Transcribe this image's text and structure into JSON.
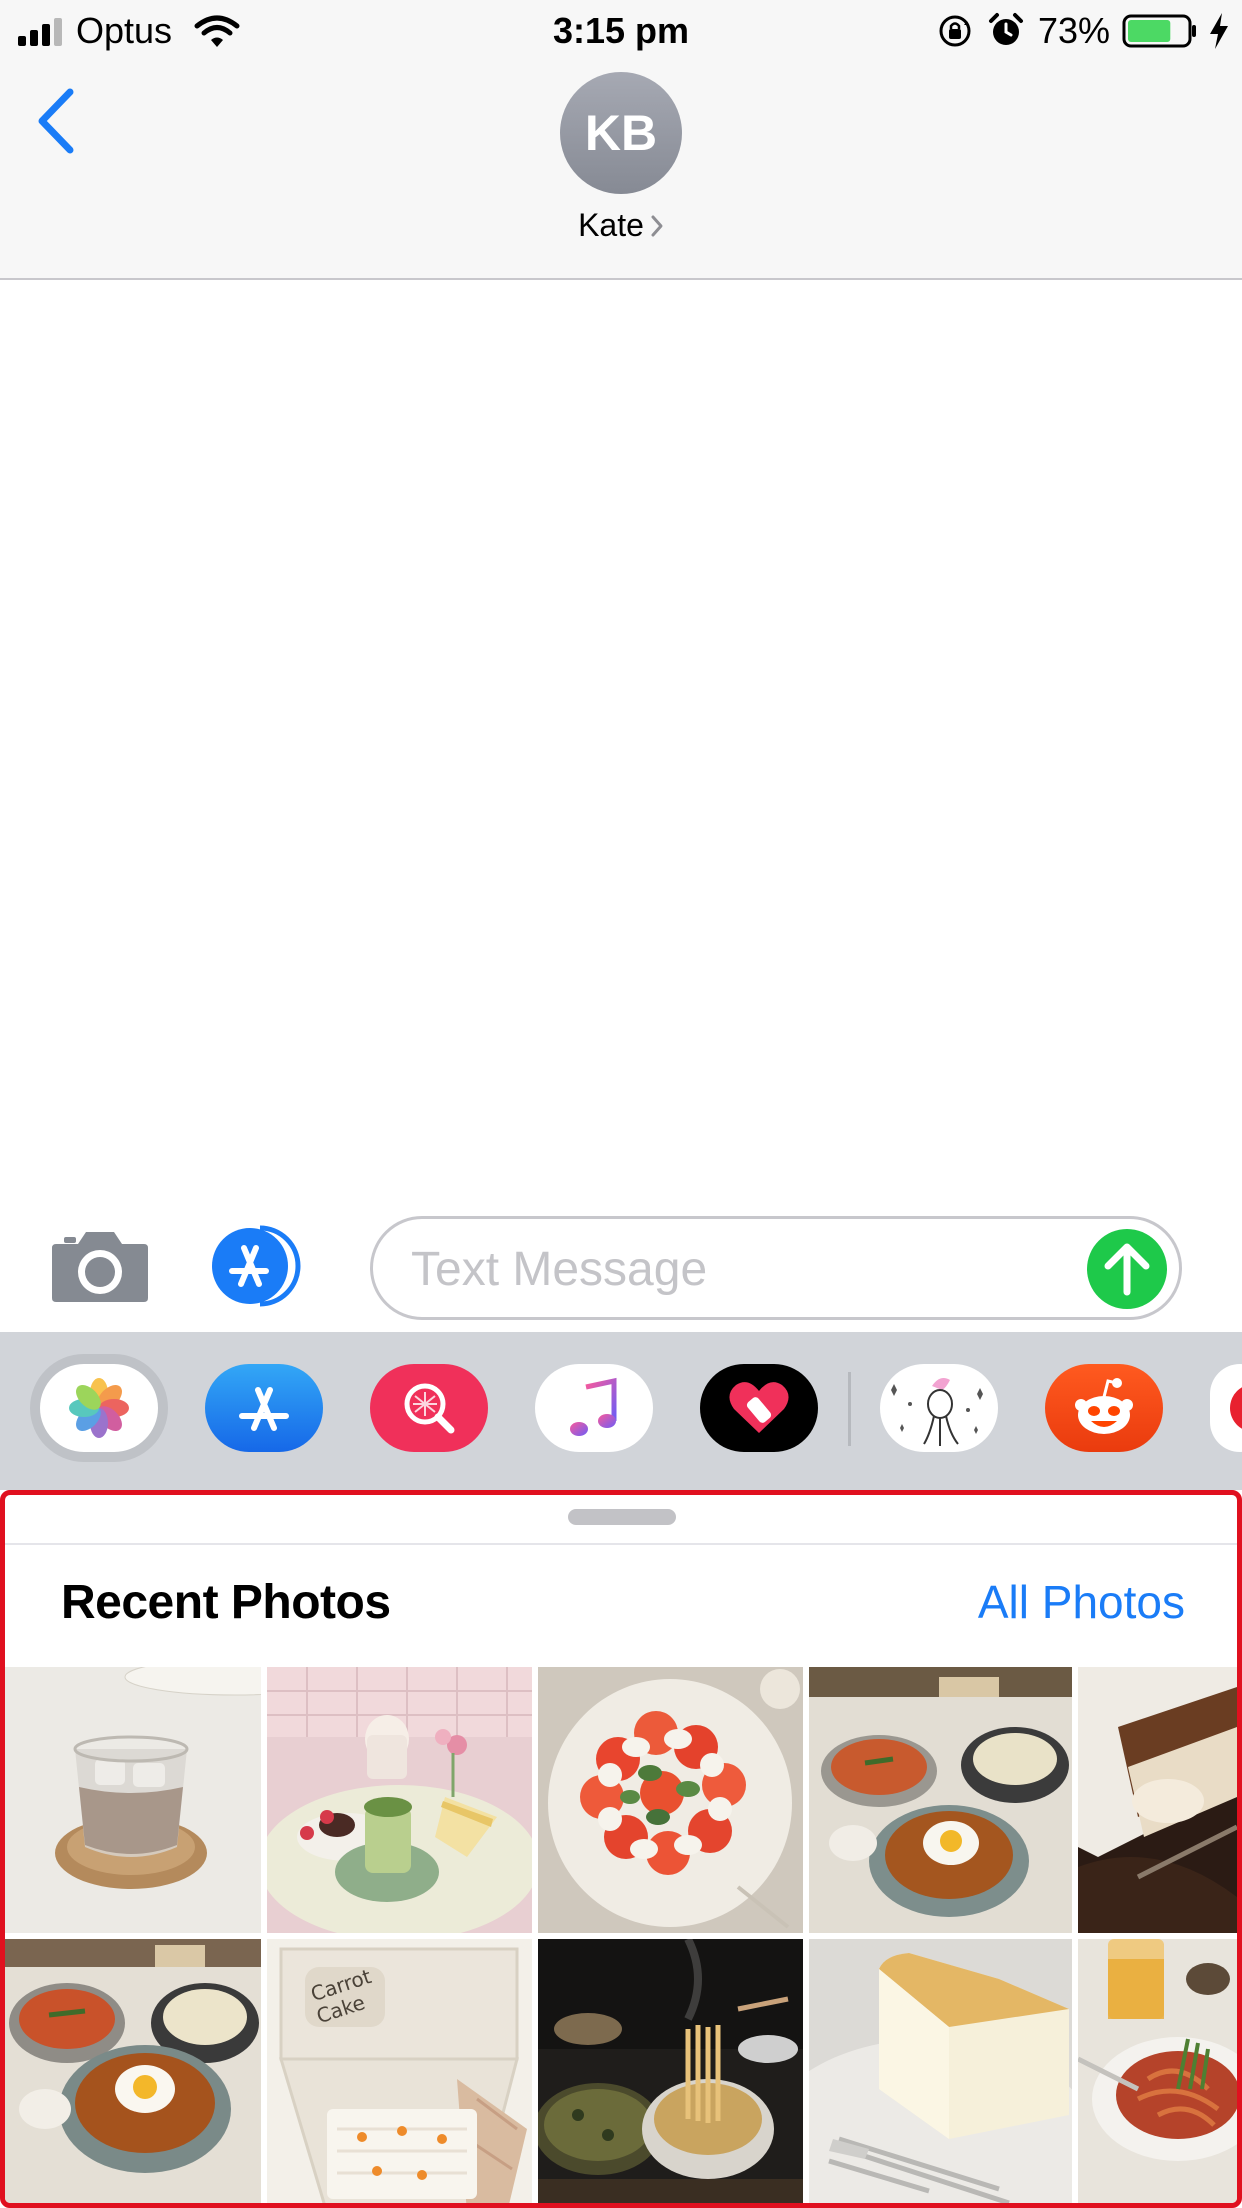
{
  "status_bar": {
    "carrier": "Optus",
    "time": "3:15 pm",
    "battery_percent": "73%",
    "battery_level": 0.73,
    "signal_bars_filled": 3,
    "signal_bars_total": 4,
    "icons": [
      "signal-icon",
      "wifi-icon",
      "orientation-lock-icon",
      "alarm-icon",
      "battery-icon",
      "charging-bolt-icon"
    ]
  },
  "header": {
    "back_icon": "chevron-left-icon",
    "avatar_initials": "KB",
    "contact_name": "Kate",
    "contact_chevron": "chevron-right-icon"
  },
  "compose": {
    "camera_icon": "camera-icon",
    "apps_icon": "app-store-icon",
    "placeholder": "Text Message",
    "send_icon": "arrow-up-icon"
  },
  "app_drawer": {
    "apps": [
      "photos-app",
      "app-store-app",
      "image-search-app",
      "music-app",
      "heart-sticker-app",
      "unicorn-sticker-app",
      "reddit-app",
      "red-app-partial"
    ],
    "selected": "photos-app"
  },
  "photo_picker": {
    "title": "Recent Photos",
    "all_photos_label": "All Photos",
    "photos": [
      "iced-latte-photo",
      "matcha-desserts-photo",
      "caprese-salad-photo",
      "curry-rice-egg-photo",
      "tiramisu-photo",
      "curry-rice-egg-photo-2",
      "carrot-cake-box-photo",
      "noodle-dinner-photo",
      "cheesecake-photo",
      "pasta-drink-photo"
    ],
    "photo_handwriting": "Carrot Cake"
  },
  "colors": {
    "ios_blue": "#1a7cf7",
    "send_green": "#1ec94a",
    "battery_green": "#4cd964",
    "highlight_red": "#e0101f",
    "drawer_gray": "#d1d4d9",
    "header_gray": "#f7f7f7"
  }
}
